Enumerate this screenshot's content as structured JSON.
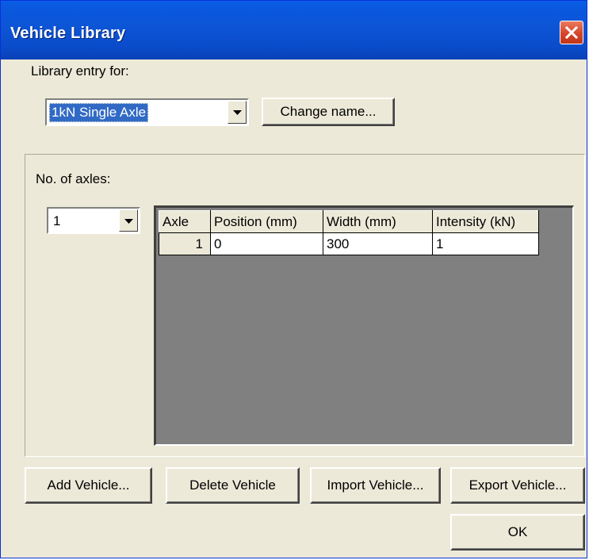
{
  "window": {
    "title": "Vehicle Library",
    "close_icon": "close-icon"
  },
  "library": {
    "entry_label": "Library entry for:",
    "selected_entry": "1kN Single Axle",
    "change_name_label": "Change name..."
  },
  "axles": {
    "label": "No. of axles:",
    "count": "1"
  },
  "grid": {
    "columns": [
      "Axle",
      "Position (mm)",
      "Width (mm)",
      "Intensity (kN)"
    ],
    "rows": [
      [
        "1",
        "0",
        "300",
        "1"
      ]
    ]
  },
  "buttons": {
    "add": "Add Vehicle...",
    "delete": "Delete Vehicle",
    "import": "Import Vehicle...",
    "export": "Export Vehicle...",
    "ok": "OK"
  },
  "colors": {
    "titlebar": "#0a58de",
    "dialog_bg": "#ece9d8",
    "selection": "#316ac5",
    "grid_bg": "#808080",
    "close_button": "#d4442b"
  }
}
